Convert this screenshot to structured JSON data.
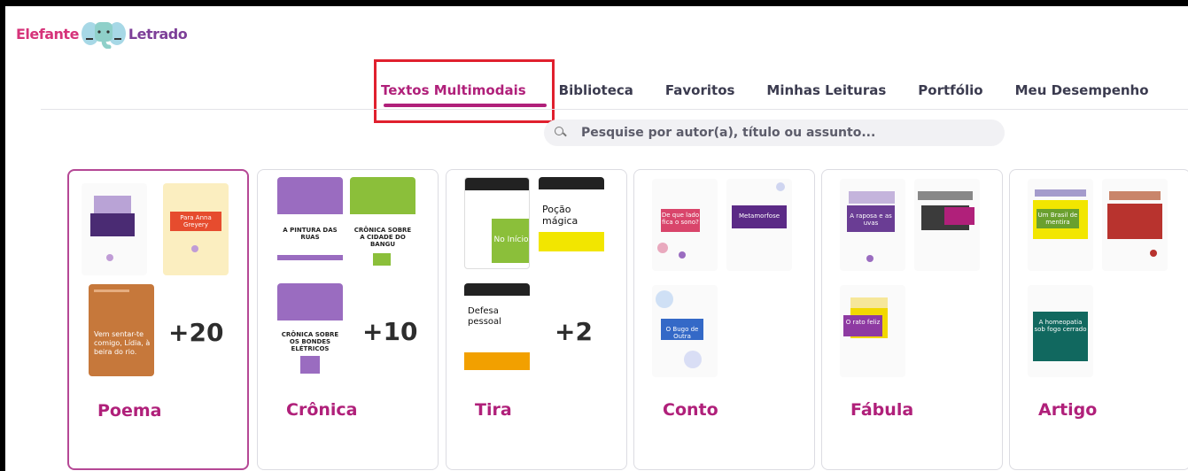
{
  "logo": {
    "word_left": "Elefante",
    "word_right": "Letrado"
  },
  "nav": {
    "items": [
      {
        "label": "Textos Multimodais",
        "active": true
      },
      {
        "label": "Biblioteca",
        "active": false
      },
      {
        "label": "Favoritos",
        "active": false
      },
      {
        "label": "Minhas Leituras",
        "active": false
      },
      {
        "label": "Portfólio",
        "active": false
      },
      {
        "label": "Meu Desempenho",
        "active": false
      }
    ]
  },
  "search": {
    "placeholder": "Pesquise por autor(a), título ou assunto..."
  },
  "categories": [
    {
      "name": "Poema",
      "count": "+20",
      "selected": true,
      "thumb_texts": [
        "Para Anna Greyery",
        "Vem sentar-te comigo, Lídia, à beira do rio."
      ]
    },
    {
      "name": "Crônica",
      "count": "+10",
      "thumb_texts": [
        "A PINTURA DAS RUAS",
        "CRÔNICA SOBRE A CIDADE DO BANGU",
        "CRÔNICA SOBRE OS BONDES ELÉTRICOS"
      ]
    },
    {
      "name": "Tira",
      "count": "+2",
      "thumb_texts": [
        "No Início",
        "Poção mágica",
        "Defesa pessoal"
      ]
    },
    {
      "name": "Conto",
      "thumb_texts": [
        "De que lado fica o sono?",
        "Metamorfose",
        "O Bugo de Outra"
      ]
    },
    {
      "name": "Fábula",
      "thumb_texts": [
        "A raposa e as uvas",
        "O rato feliz"
      ]
    },
    {
      "name": "Artigo",
      "thumb_texts": [
        "Um Brasil de mentira",
        "A homeopatia sob fogo cerrado"
      ]
    }
  ]
}
